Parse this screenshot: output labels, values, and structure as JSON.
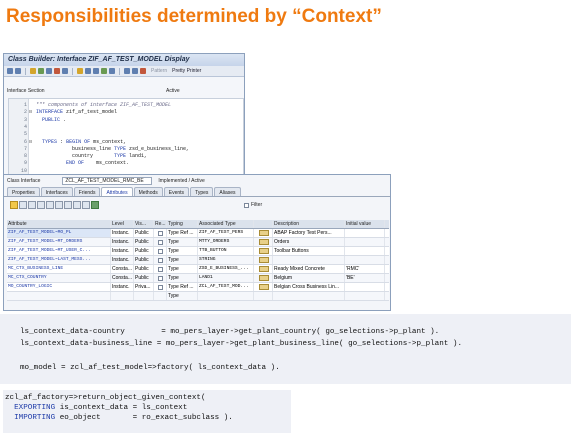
{
  "slide": {
    "title": "Responsibilities determined by “Context”"
  },
  "class_builder": {
    "window_title": "Class Builder: Interface ZIF_AF_TEST_MODEL Display",
    "toolbar": {
      "pattern_label": "Pattern",
      "pretty_printer_label": "Pretty Printer"
    },
    "status_left": "Interface Section",
    "status_right": "Active",
    "code": [
      {
        "no": "1",
        "text": "*\"* components of interface ZIF_AF_TEST_MODEL"
      },
      {
        "no": "2",
        "text": "INTERFACE zif_af_test_model"
      },
      {
        "no": "3",
        "text": "  PUBLIC ."
      },
      {
        "no": "4",
        "text": ""
      },
      {
        "no": "5",
        "text": ""
      },
      {
        "no": "6",
        "text": "  TYPES : BEGIN OF ms_context,"
      },
      {
        "no": "7",
        "text": "            business_line TYPE zsd_e_business_line,"
      },
      {
        "no": "8",
        "text": "            country       TYPE land1,"
      },
      {
        "no": "9",
        "text": "          END OF    ms_context."
      },
      {
        "no": "10",
        "text": ""
      }
    ]
  },
  "class_interface": {
    "label": "Class Interface",
    "name": "ZCL_AF_TEST_MODEL_RMC_BE",
    "status": "Implemented / Active",
    "tabs": [
      "Properties",
      "Interfaces",
      "Friends",
      "Attributes",
      "Methods",
      "Events",
      "Types",
      "Aliases"
    ],
    "active_tab": "Attributes",
    "filter_label": "Filter",
    "columns": [
      "Attribute",
      "Level",
      "Vis...",
      "Re...",
      "Typing",
      "Associated Type",
      "",
      "Description",
      "Initial value"
    ],
    "rows": [
      {
        "attribute": "ZIF_AF_TEST_MODEL~MO_PL",
        "level": "Instanc.",
        "visibility": "Public",
        "typing": "Type Ref ...",
        "assoc_type": "ZIF_AF_TEST_PERS",
        "description": "ABAP Factory Test Pers...",
        "initial": ""
      },
      {
        "attribute": "ZIF_AF_TEST_MODEL~MT_ORDERS",
        "level": "Instanc.",
        "visibility": "Public",
        "typing": "Type",
        "assoc_type": "MTTY_ORDERS",
        "description": "Orders",
        "initial": ""
      },
      {
        "attribute": "ZIF_AF_TEST_MODEL~MT_USER_C...",
        "level": "Instanc.",
        "visibility": "Public",
        "typing": "Type",
        "assoc_type": "TTB_BUTTON",
        "description": "Toolbar Buttons",
        "initial": ""
      },
      {
        "attribute": "ZIF_AF_TEST_MODEL~LAST_MESS...",
        "level": "Instanc.",
        "visibility": "Public",
        "typing": "Type",
        "assoc_type": "STRING",
        "description": "",
        "initial": ""
      },
      {
        "attribute": "MC_CTX_BUSINESS_LINE",
        "level": "Consta...",
        "visibility": "Public",
        "typing": "Type",
        "assoc_type": "ZSD_E_BUSINESS_...",
        "description": "Ready Mixed Concrete",
        "initial": "'RMC'"
      },
      {
        "attribute": "MC_CTX_COUNTRY",
        "level": "Consta...",
        "visibility": "Public",
        "typing": "Type",
        "assoc_type": "LAND1",
        "description": "Belgium",
        "initial": "'BE'"
      },
      {
        "attribute": "MO_COUNTRY_LOGIC",
        "level": "Instanc.",
        "visibility": "Priva...",
        "typing": "Type Ref ...",
        "assoc_type": "ZCL_AF_TEST_MOD...",
        "description": "Belgian Cross Business Lin...",
        "initial": ""
      },
      {
        "attribute": "",
        "level": "",
        "visibility": "",
        "typing": "Type",
        "assoc_type": "",
        "description": "",
        "initial": ""
      }
    ]
  },
  "snippet1": {
    "lines": [
      "ls_context_data-country        = mo_pers_layer->get_plant_country( go_selections->p_plant ).",
      "ls_context_data-business_line = mo_pers_layer->get_plant_business_line( go_selections->p_plant ).",
      "",
      "mo_model = zcl_af_test_model=>factory( ls_context_data )."
    ]
  },
  "snippet2": {
    "line1": "zcl_af_factory=>return_object_given_context(",
    "exporting_kw": "  EXPORTING",
    "exporting_rest": " is_context_data = ls_context",
    "importing_kw": "  IMPORTING",
    "importing_rest": " eo_object       = ro_exact_subclass )."
  }
}
